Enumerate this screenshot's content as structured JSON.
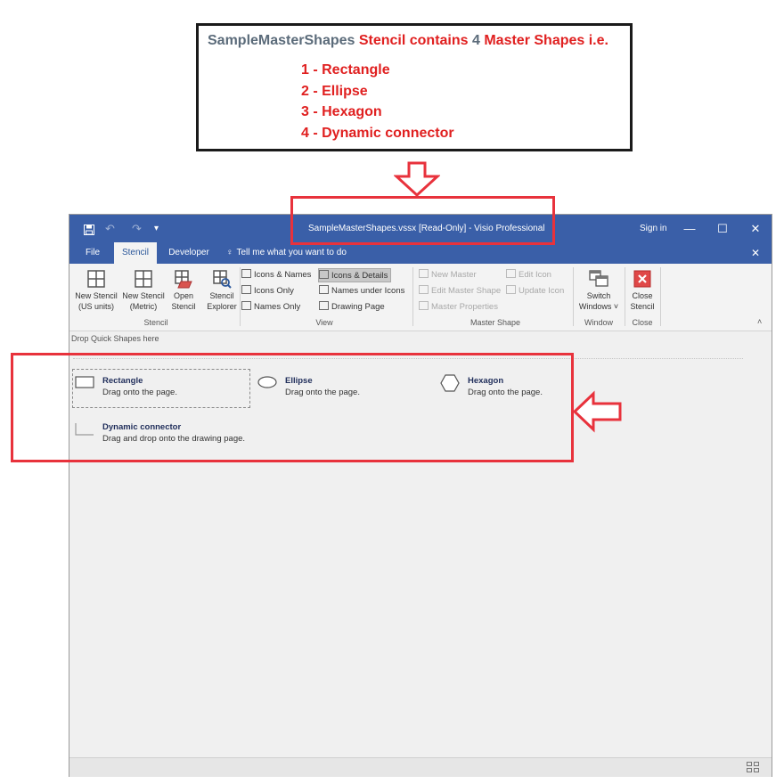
{
  "annotation": {
    "title_parts": [
      {
        "text": "SampleMasterShapes",
        "color": "#5b6b7a"
      },
      {
        "text": " Stencil contains ",
        "color": "#e02020"
      },
      {
        "text": "4",
        "color": "#5b6b7a"
      },
      {
        "text": " Master Shapes i.e.",
        "color": "#e02020"
      }
    ],
    "items": [
      "1 - Rectangle",
      "2 - Ellipse",
      "3 - Hexagon",
      "4 - Dynamic connector"
    ]
  },
  "colors": {
    "highlight_red": "#e8323c",
    "annotation_red": "#e02020",
    "title_bar_blue": "#3a5fa8"
  },
  "window": {
    "qat": {
      "save_icon": "save-icon",
      "undo_glyph": "↶",
      "redo_glyph": "↷",
      "customize_glyph": "▾"
    },
    "title": "SampleMasterShapes.vssx  [Read-Only] - Visio Professional",
    "sign_in": "Sign in",
    "controls": {
      "minimize": "—",
      "restore": "☐",
      "close": "✕"
    },
    "tabs": [
      {
        "label": "File",
        "active": false
      },
      {
        "label": "Stencil",
        "active": true
      },
      {
        "label": "Developer",
        "active": false
      }
    ],
    "tell_me_icon": "lightbulb-icon",
    "tell_me": "Tell me what you want to do",
    "ribbon_close": "✕",
    "ribbon": {
      "stencil_group": {
        "label": "Stencil",
        "buttons": [
          {
            "line1": "New Stencil",
            "line2": "(US units)"
          },
          {
            "line1": "New Stencil",
            "line2": "(Metric)"
          },
          {
            "line1": "Open",
            "line2": "Stencil"
          },
          {
            "line1": "Stencil",
            "line2": "Explorer"
          }
        ]
      },
      "view_group": {
        "label": "View",
        "options": [
          "Icons & Names",
          "Icons Only",
          "Names Only",
          "Icons & Details",
          "Names under Icons",
          "Drawing Page"
        ],
        "selected": "Icons & Details"
      },
      "master_shape_group": {
        "label": "Master Shape",
        "options": [
          "New Master",
          "Edit Master Shape",
          "Master Properties",
          "Edit Icon",
          "Update Icon"
        ]
      },
      "window_group": {
        "label": "Window",
        "button": {
          "line1": "Switch",
          "line2": "Windows ˅"
        }
      },
      "close_group": {
        "label": "Close",
        "button": {
          "line1": "Close",
          "line2": "Stencil"
        }
      },
      "collapse_glyph": "˄"
    },
    "quick_shapes_hint": "Drop Quick Shapes here",
    "shapes": [
      {
        "name": "Rectangle",
        "desc": "Drag onto the page.",
        "icon": "rectangle-icon"
      },
      {
        "name": "Ellipse",
        "desc": "Drag onto the page.",
        "icon": "ellipse-icon"
      },
      {
        "name": "Hexagon",
        "desc": "Drag onto the page.",
        "icon": "hexagon-icon"
      },
      {
        "name": "Dynamic connector",
        "desc": "Drag and drop onto the drawing page.",
        "icon": "connector-icon"
      }
    ],
    "status_icon": "view-toggle-icon"
  }
}
